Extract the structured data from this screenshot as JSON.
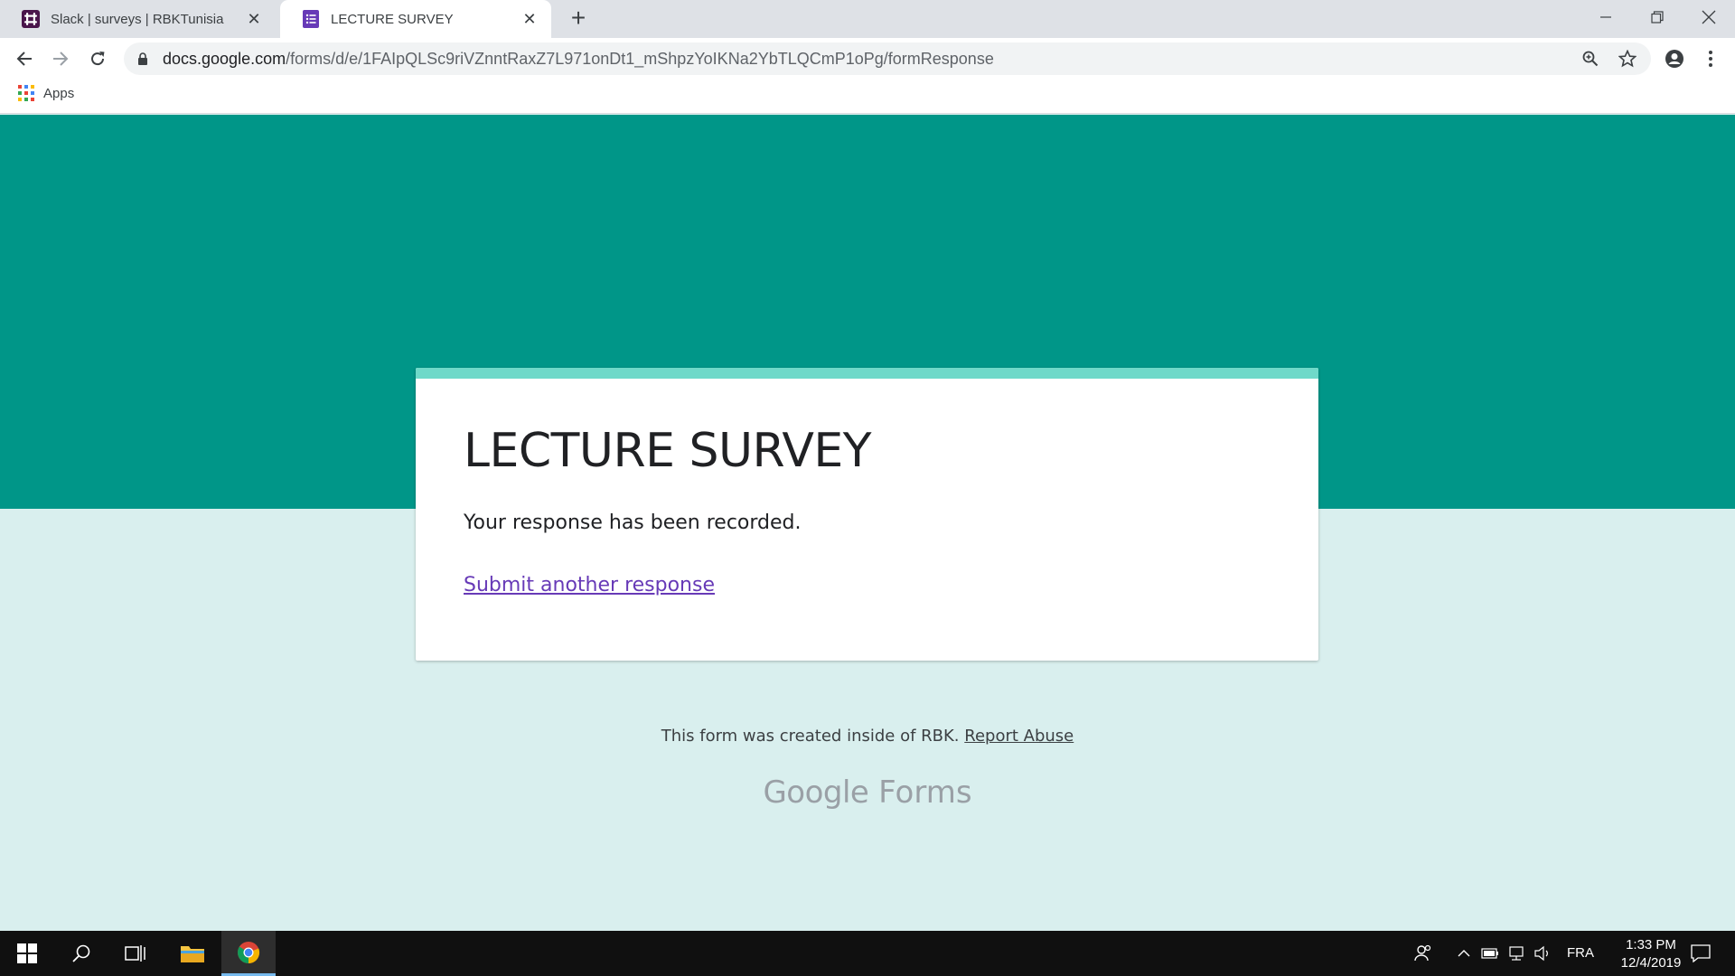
{
  "browser": {
    "tabs": [
      {
        "label": "Slack | surveys | RBKTunisia",
        "icon": "slack-icon",
        "active": false
      },
      {
        "label": "LECTURE SURVEY",
        "icon": "google-forms-icon",
        "active": true
      }
    ],
    "url_domain": "docs.google.com",
    "url_path": "/forms/d/e/1FAIpQLSc9riVZnntRaxZ7L971onDt1_mShpzYoIKNa2YbTLQCmP1oPg/formResponse",
    "bookmarks": {
      "apps_label": "Apps"
    }
  },
  "form": {
    "title": "LECTURE SURVEY",
    "confirmation": "Your response has been recorded.",
    "another_link": "Submit another response",
    "footer_text": "This form was created inside of RBK.",
    "report_link": "Report Abuse",
    "brand_google": "Google",
    "brand_forms": "Forms",
    "colors": {
      "header": "#009688",
      "accent": "#6fd9c9",
      "background": "#d9efee",
      "link": "#673ab7"
    }
  },
  "taskbar": {
    "language": "FRA",
    "time": "1:33 PM",
    "date": "12/4/2019"
  }
}
